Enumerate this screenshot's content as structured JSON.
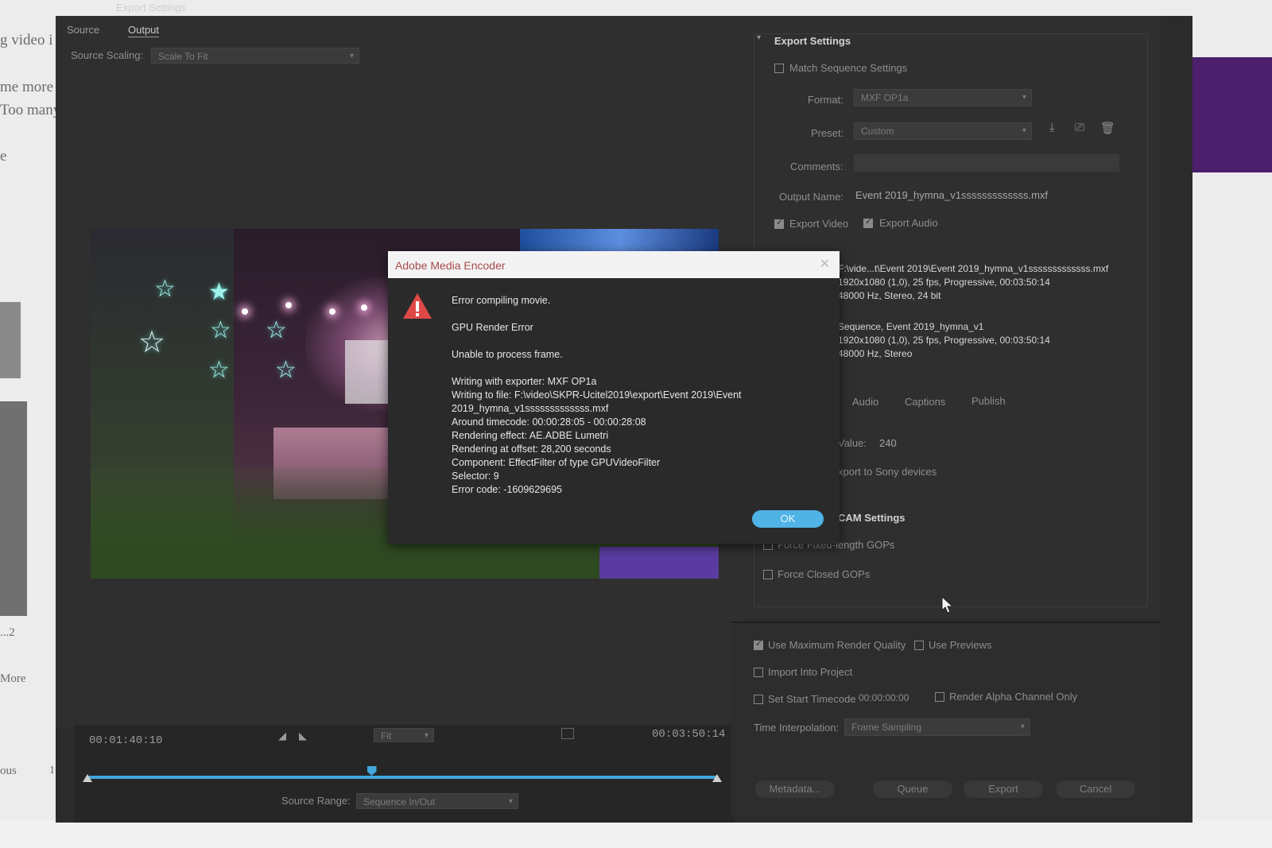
{
  "background_page": {
    "text_lines": [
      "g video i",
      "me more",
      "Too many",
      "e",
      "...2",
      "More",
      "ous",
      "1"
    ]
  },
  "window": {
    "title": "Export Settings"
  },
  "left_panel": {
    "tabs": [
      {
        "label": "Source"
      },
      {
        "label": "Output"
      }
    ],
    "active_tab": "Output",
    "source_scaling_label": "Source Scaling:",
    "source_scaling_value": "Scale To Fit"
  },
  "timeline": {
    "current_timecode": "00:01:40:10",
    "end_timecode": "00:03:50:14",
    "fit_label": "Fit",
    "source_range_label": "Source Range:",
    "source_range_value": "Sequence In/Out",
    "playhead_fraction": 0.45
  },
  "export_settings": {
    "section_title": "Export Settings",
    "match_sequence": {
      "label": "Match Sequence Settings",
      "checked": false
    },
    "format_label": "Format:",
    "format_value": "MXF OP1a",
    "preset_label": "Preset:",
    "preset_value": "Custom",
    "comments_label": "Comments:",
    "output_name_label": "Output Name:",
    "output_name_value": "Event 2019_hymna_v1sssssssssssss.mxf",
    "export_video": {
      "label": "Export Video",
      "checked": true
    },
    "export_audio": {
      "label": "Export Audio",
      "checked": true
    },
    "summary_output": [
      "F:\\vide...t\\Event 2019\\Event 2019_hymna_v1sssssssssssss.mxf",
      "1920x1080 (1,0), 25 fps, Progressive, 00:03:50:14",
      "48000 Hz, Stereo, 24 bit"
    ],
    "summary_source": [
      "Sequence, Event 2019_hymna_v1",
      "1920x1080 (1,0), 25 fps, Progressive, 00:03:50:14",
      "48000 Hz, Stereo"
    ],
    "tabs": [
      "Audio",
      "Captions",
      "Publish"
    ],
    "value_label": "Value:",
    "value_number": "240",
    "sony_text": "xport to Sony devices",
    "cam_settings_title": "CAM Settings",
    "force_fixed_gops": {
      "label": "Force Fixed-length GOPs",
      "checked": false
    },
    "force_closed_gops": {
      "label": "Force Closed GOPs",
      "checked": false
    }
  },
  "bottom_options": {
    "use_max_render_quality": {
      "label": "Use Maximum Render Quality",
      "checked": true
    },
    "use_previews": {
      "label": "Use Previews",
      "checked": false
    },
    "import_into_project": {
      "label": "Import Into Project",
      "checked": false
    },
    "set_start_timecode": {
      "label": "Set Start Timecode",
      "checked": false,
      "value": "00:00:00:00"
    },
    "render_alpha": {
      "label": "Render Alpha Channel Only",
      "checked": false
    },
    "time_interpolation_label": "Time Interpolation:",
    "time_interpolation_value": "Frame Sampling",
    "buttons": {
      "metadata": "Metadata...",
      "queue": "Queue",
      "export": "Export",
      "cancel": "Cancel"
    }
  },
  "dialog": {
    "title": "Adobe Media Encoder",
    "lines": [
      "Error compiling movie.",
      "GPU Render Error",
      "Unable to process frame.",
      "Writing with exporter: MXF OP1a",
      "Writing to file: F:\\video\\SKPR-Ucitel2019\\export\\Event 2019\\Event",
      "2019_hymna_v1sssssssssssss.mxf",
      "Around timecode: 00:00:28:05 - 00:00:28:08",
      "Rendering effect: AE.ADBE Lumetri",
      "Rendering at offset: 28,200 seconds",
      "Component: EffectFilter of type GPUVideoFilter",
      "Selector: 9",
      "Error code: -1609629695"
    ],
    "ok_label": "OK",
    "close_glyph": "✕"
  },
  "colors": {
    "accent_blue": "#43a6dc",
    "ok_button": "#4fb3e6",
    "warning_red": "#e04848",
    "dialog_title_text": "#a64b4b"
  }
}
